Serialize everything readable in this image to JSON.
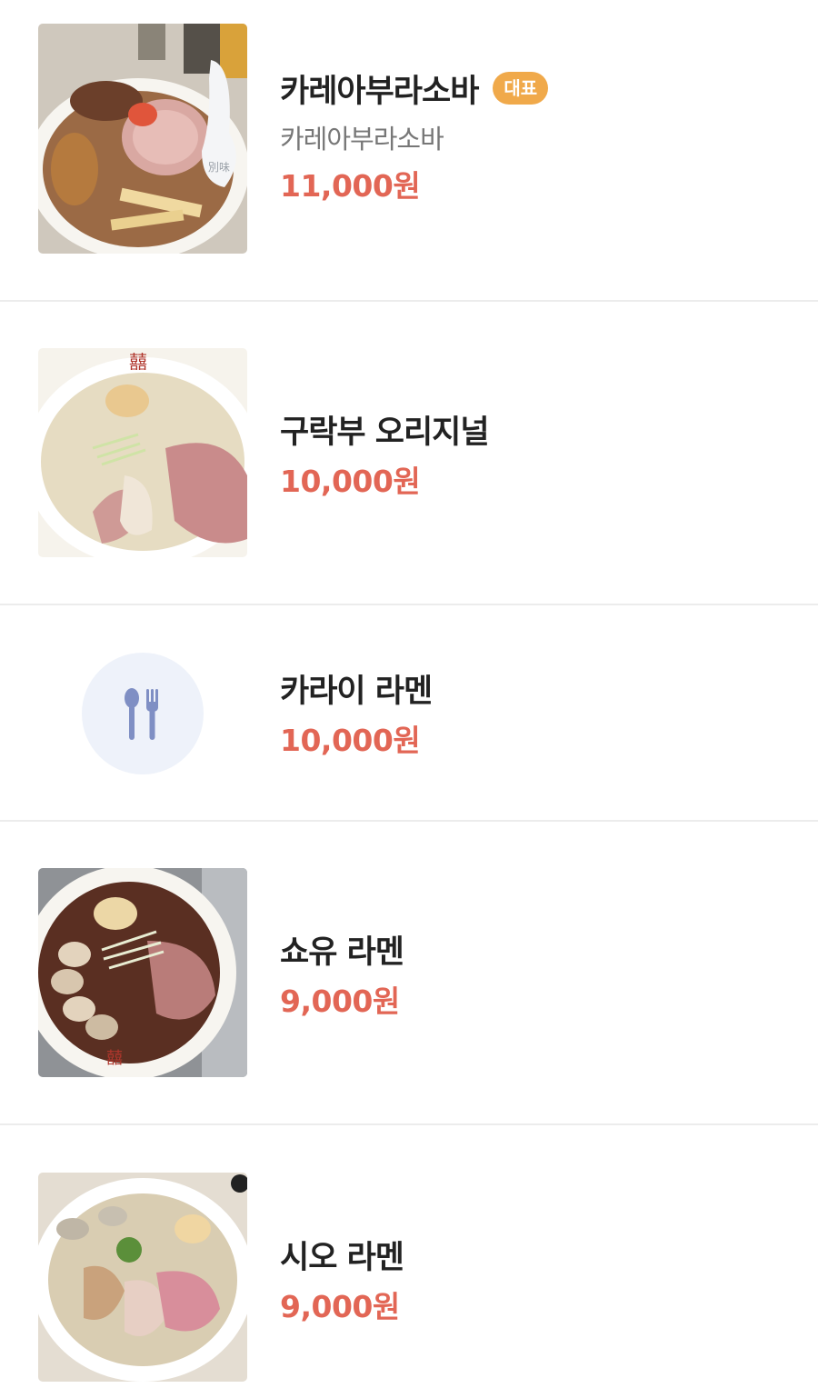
{
  "menu": {
    "items": [
      {
        "name": "카레아부라소바",
        "badge": "대표",
        "description": "카레아부라소바",
        "price": "11,000원",
        "image_icon": "ramen-photo",
        "spoon_label": "別味"
      },
      {
        "name": "구락부 오리지널",
        "price": "10,000원",
        "image_icon": "ramen-photo"
      },
      {
        "name": "카라이 라멘",
        "price": "10,000원",
        "image_icon": "utensils-placeholder-icon"
      },
      {
        "name": "쇼유 라멘",
        "price": "9,000원",
        "image_icon": "ramen-photo"
      },
      {
        "name": "시오 라멘",
        "price": "9,000원",
        "image_icon": "ramen-photo"
      }
    ]
  },
  "colors": {
    "price": "#e26655",
    "badge": "#f0a94a",
    "name": "#222222",
    "description": "#777777",
    "placeholder_bg": "#eef2fa",
    "placeholder_icon": "#7f8fc4",
    "divider": "#ececec"
  }
}
